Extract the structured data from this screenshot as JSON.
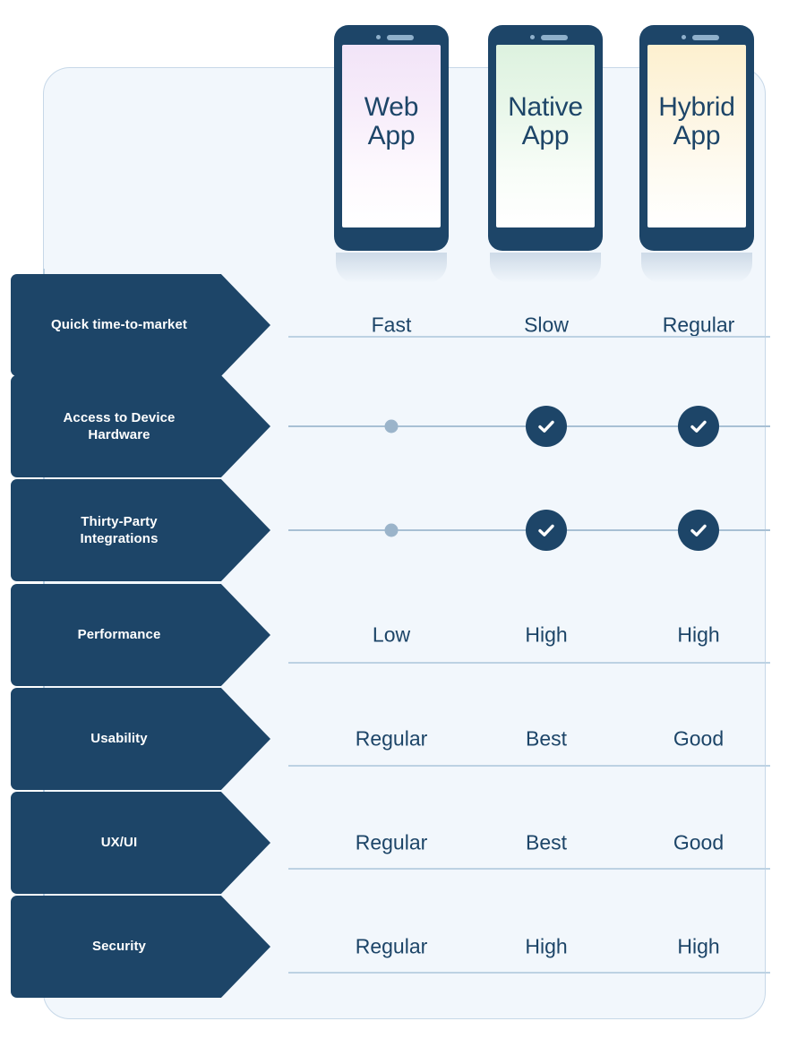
{
  "card": {
    "background_color": "#f2f7fc",
    "border_color": "#c7d8e8"
  },
  "theme": {
    "navy": "#1d4568",
    "line": "#bdd2e3",
    "muted_dot": "#9bb4ca"
  },
  "columns": [
    {
      "id": "web",
      "title_line1": "Web",
      "title_line2": "App",
      "screen_color": "#f2e4f8"
    },
    {
      "id": "native",
      "title_line1": "Native",
      "title_line2": "App",
      "screen_color": "#ddf2df"
    },
    {
      "id": "hybrid",
      "title_line1": "Hybrid",
      "title_line2": "App",
      "screen_color": "#fdf0cf"
    }
  ],
  "chart_data": {
    "type": "table",
    "title": "Web App vs Native App vs Hybrid App comparison",
    "categories": [
      "Web App",
      "Native App",
      "Hybrid App"
    ],
    "rows": [
      {
        "criterion": "Quick time-to-market",
        "criterion_line1": "Quick time-to-market",
        "criterion_line2": "",
        "cell_type": "text",
        "values": [
          "Fast",
          "Slow",
          "Regular"
        ]
      },
      {
        "criterion": "Access to Device Hardware",
        "criterion_line1": "Access to Device",
        "criterion_line2": "Hardware",
        "cell_type": "icon",
        "values": [
          "no",
          "yes",
          "yes"
        ],
        "icons": [
          "muted-dot-icon",
          "check-circle-icon",
          "check-circle-icon"
        ]
      },
      {
        "criterion": "Thirty-Party Integrations",
        "criterion_line1": "Thirty-Party",
        "criterion_line2": "Integrations",
        "cell_type": "icon",
        "values": [
          "no",
          "yes",
          "yes"
        ],
        "icons": [
          "muted-dot-icon",
          "check-circle-icon",
          "check-circle-icon"
        ]
      },
      {
        "criterion": "Performance",
        "criterion_line1": "Performance",
        "criterion_line2": "",
        "cell_type": "text",
        "values": [
          "Low",
          "High",
          "High"
        ]
      },
      {
        "criterion": "Usability",
        "criterion_line1": "Usability",
        "criterion_line2": "",
        "cell_type": "text",
        "values": [
          "Regular",
          "Best",
          "Good"
        ]
      },
      {
        "criterion": "UX/UI",
        "criterion_line1": "UX/UI",
        "criterion_line2": "",
        "cell_type": "text",
        "values": [
          "Regular",
          "Best",
          "Good"
        ]
      },
      {
        "criterion": "Security",
        "criterion_line1": "Security",
        "criterion_line2": "",
        "cell_type": "text",
        "values": [
          "Regular",
          "High",
          "High"
        ]
      }
    ]
  }
}
